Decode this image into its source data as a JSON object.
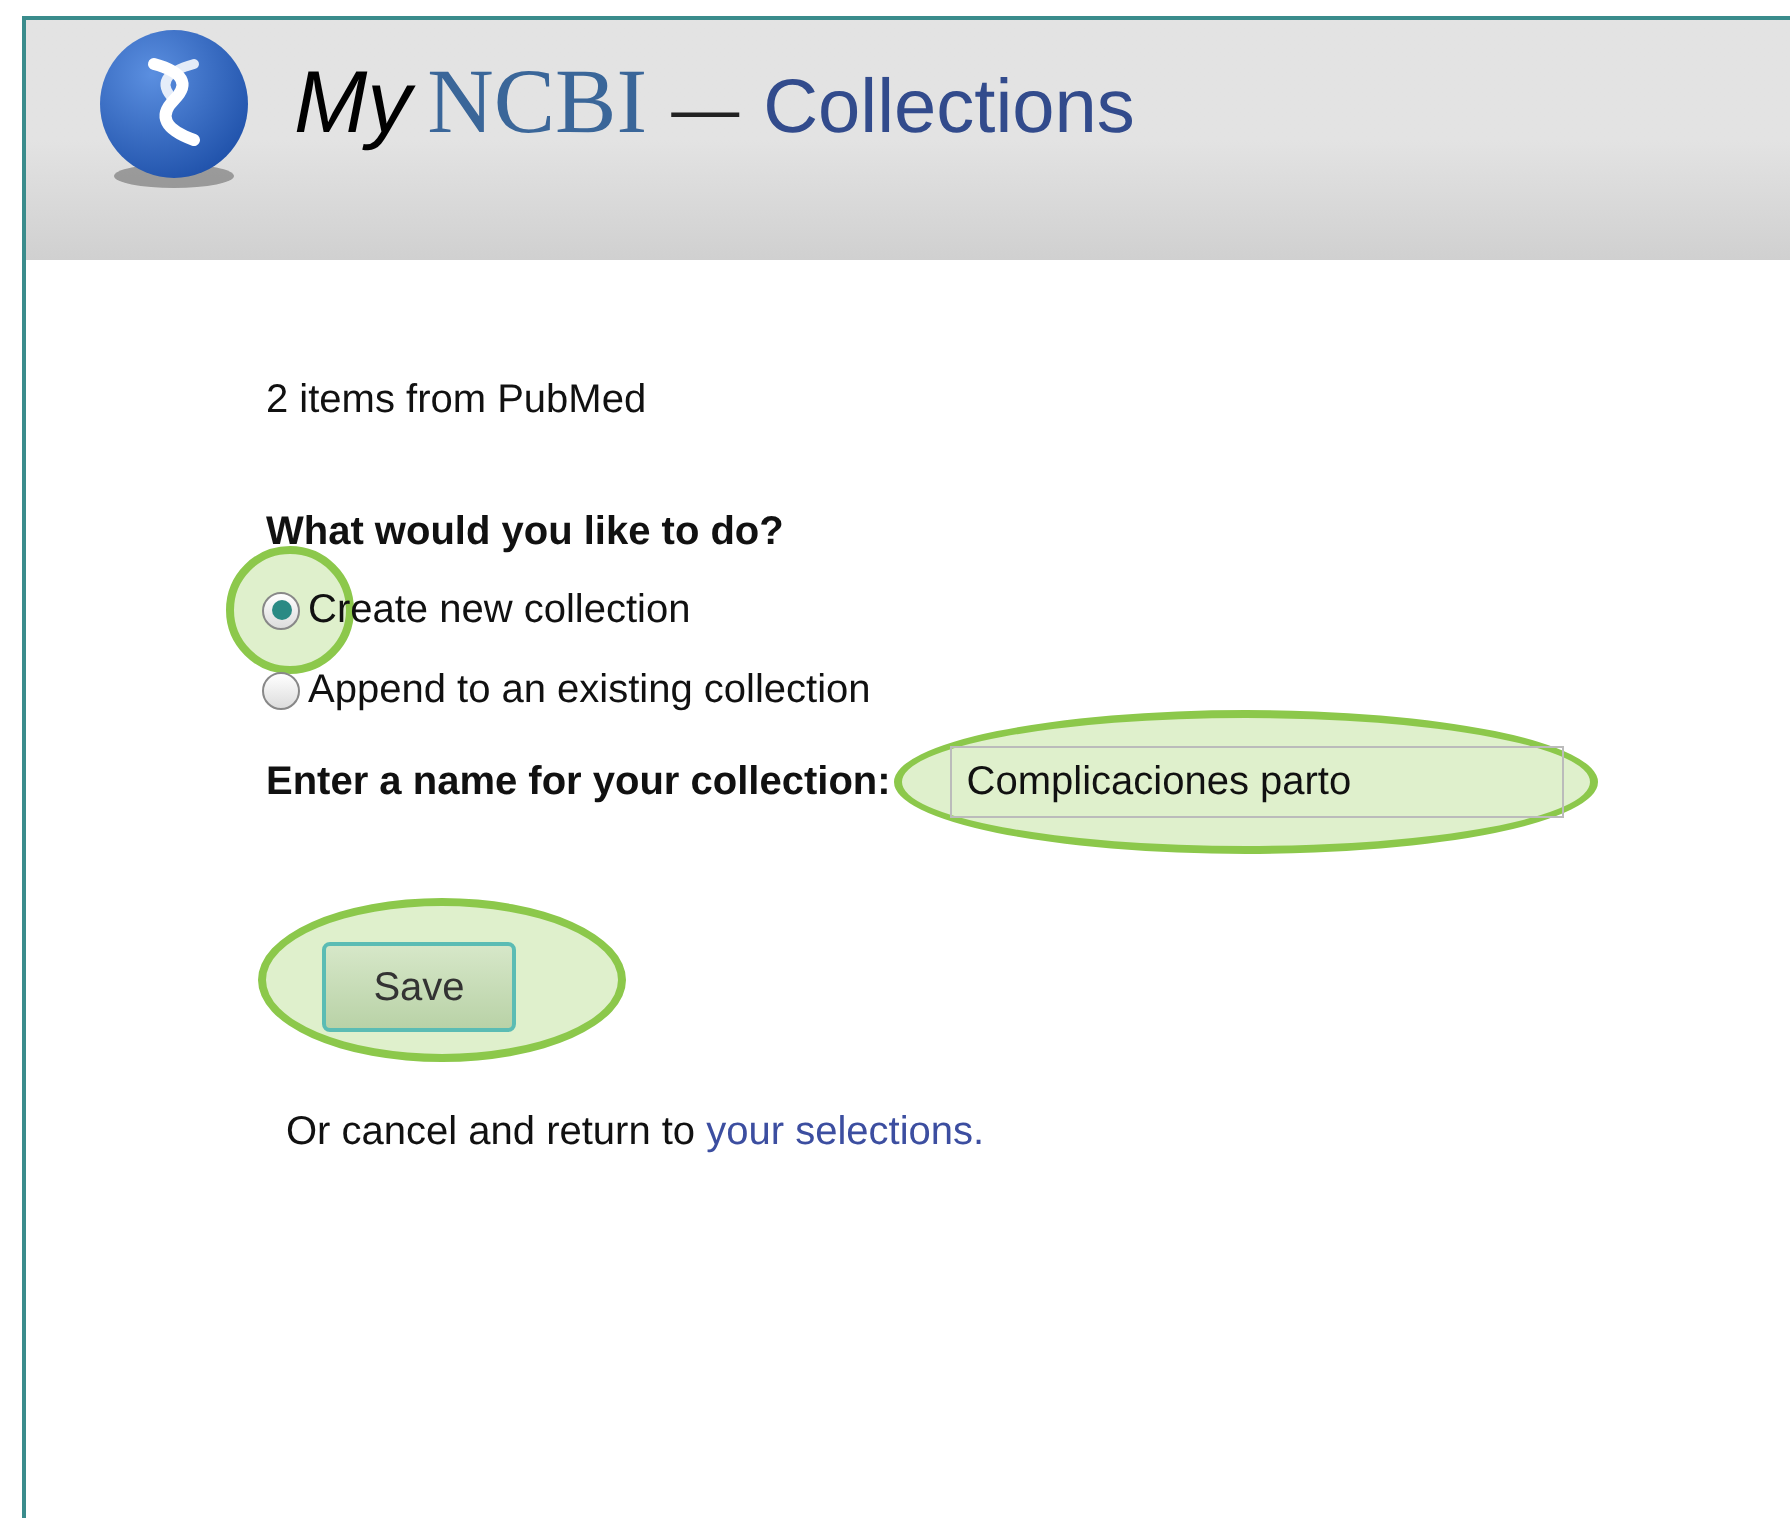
{
  "header": {
    "brand_my": "My",
    "brand_ncbi": "NCBI",
    "dash": "—",
    "title": "Collections"
  },
  "source_line": "2 items from PubMed",
  "question": "What would you like to do?",
  "options": [
    {
      "label": "Create new collection",
      "selected": true,
      "highlighted": true
    },
    {
      "label": "Append to an existing collection",
      "selected": false,
      "highlighted": false
    }
  ],
  "name_field": {
    "label": "Enter a name for your collection:",
    "value": "Complicaciones parto",
    "highlighted": true
  },
  "save_button": {
    "label": "Save",
    "highlighted": true
  },
  "cancel_line": {
    "text": "Or cancel and return to",
    "link": "your selections."
  }
}
